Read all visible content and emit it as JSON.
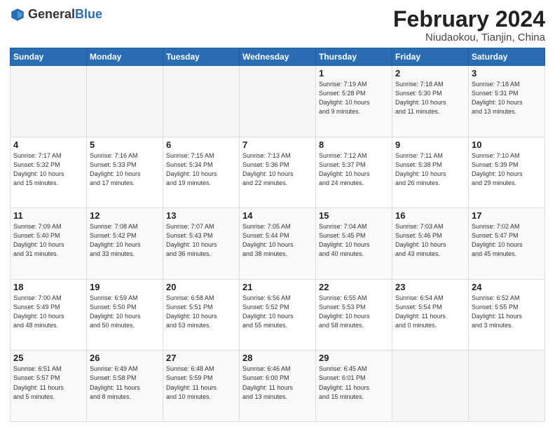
{
  "header": {
    "logo": {
      "general": "General",
      "blue": "Blue"
    },
    "title": "February 2024",
    "subtitle": "Niudaokou, Tianjin, China"
  },
  "days_of_week": [
    "Sunday",
    "Monday",
    "Tuesday",
    "Wednesday",
    "Thursday",
    "Friday",
    "Saturday"
  ],
  "weeks": [
    [
      {
        "num": "",
        "info": ""
      },
      {
        "num": "",
        "info": ""
      },
      {
        "num": "",
        "info": ""
      },
      {
        "num": "",
        "info": ""
      },
      {
        "num": "1",
        "info": "Sunrise: 7:19 AM\nSunset: 5:28 PM\nDaylight: 10 hours\nand 9 minutes."
      },
      {
        "num": "2",
        "info": "Sunrise: 7:18 AM\nSunset: 5:30 PM\nDaylight: 10 hours\nand 11 minutes."
      },
      {
        "num": "3",
        "info": "Sunrise: 7:18 AM\nSunset: 5:31 PM\nDaylight: 10 hours\nand 13 minutes."
      }
    ],
    [
      {
        "num": "4",
        "info": "Sunrise: 7:17 AM\nSunset: 5:32 PM\nDaylight: 10 hours\nand 15 minutes."
      },
      {
        "num": "5",
        "info": "Sunrise: 7:16 AM\nSunset: 5:33 PM\nDaylight: 10 hours\nand 17 minutes."
      },
      {
        "num": "6",
        "info": "Sunrise: 7:15 AM\nSunset: 5:34 PM\nDaylight: 10 hours\nand 19 minutes."
      },
      {
        "num": "7",
        "info": "Sunrise: 7:13 AM\nSunset: 5:36 PM\nDaylight: 10 hours\nand 22 minutes."
      },
      {
        "num": "8",
        "info": "Sunrise: 7:12 AM\nSunset: 5:37 PM\nDaylight: 10 hours\nand 24 minutes."
      },
      {
        "num": "9",
        "info": "Sunrise: 7:11 AM\nSunset: 5:38 PM\nDaylight: 10 hours\nand 26 minutes."
      },
      {
        "num": "10",
        "info": "Sunrise: 7:10 AM\nSunset: 5:39 PM\nDaylight: 10 hours\nand 29 minutes."
      }
    ],
    [
      {
        "num": "11",
        "info": "Sunrise: 7:09 AM\nSunset: 5:40 PM\nDaylight: 10 hours\nand 31 minutes."
      },
      {
        "num": "12",
        "info": "Sunrise: 7:08 AM\nSunset: 5:42 PM\nDaylight: 10 hours\nand 33 minutes."
      },
      {
        "num": "13",
        "info": "Sunrise: 7:07 AM\nSunset: 5:43 PM\nDaylight: 10 hours\nand 36 minutes."
      },
      {
        "num": "14",
        "info": "Sunrise: 7:05 AM\nSunset: 5:44 PM\nDaylight: 10 hours\nand 38 minutes."
      },
      {
        "num": "15",
        "info": "Sunrise: 7:04 AM\nSunset: 5:45 PM\nDaylight: 10 hours\nand 40 minutes."
      },
      {
        "num": "16",
        "info": "Sunrise: 7:03 AM\nSunset: 5:46 PM\nDaylight: 10 hours\nand 43 minutes."
      },
      {
        "num": "17",
        "info": "Sunrise: 7:02 AM\nSunset: 5:47 PM\nDaylight: 10 hours\nand 45 minutes."
      }
    ],
    [
      {
        "num": "18",
        "info": "Sunrise: 7:00 AM\nSunset: 5:49 PM\nDaylight: 10 hours\nand 48 minutes."
      },
      {
        "num": "19",
        "info": "Sunrise: 6:59 AM\nSunset: 5:50 PM\nDaylight: 10 hours\nand 50 minutes."
      },
      {
        "num": "20",
        "info": "Sunrise: 6:58 AM\nSunset: 5:51 PM\nDaylight: 10 hours\nand 53 minutes."
      },
      {
        "num": "21",
        "info": "Sunrise: 6:56 AM\nSunset: 5:52 PM\nDaylight: 10 hours\nand 55 minutes."
      },
      {
        "num": "22",
        "info": "Sunrise: 6:55 AM\nSunset: 5:53 PM\nDaylight: 10 hours\nand 58 minutes."
      },
      {
        "num": "23",
        "info": "Sunrise: 6:54 AM\nSunset: 5:54 PM\nDaylight: 11 hours\nand 0 minutes."
      },
      {
        "num": "24",
        "info": "Sunrise: 6:52 AM\nSunset: 5:55 PM\nDaylight: 11 hours\nand 3 minutes."
      }
    ],
    [
      {
        "num": "25",
        "info": "Sunrise: 6:51 AM\nSunset: 5:57 PM\nDaylight: 11 hours\nand 5 minutes."
      },
      {
        "num": "26",
        "info": "Sunrise: 6:49 AM\nSunset: 5:58 PM\nDaylight: 11 hours\nand 8 minutes."
      },
      {
        "num": "27",
        "info": "Sunrise: 6:48 AM\nSunset: 5:59 PM\nDaylight: 11 hours\nand 10 minutes."
      },
      {
        "num": "28",
        "info": "Sunrise: 6:46 AM\nSunset: 6:00 PM\nDaylight: 11 hours\nand 13 minutes."
      },
      {
        "num": "29",
        "info": "Sunrise: 6:45 AM\nSunset: 6:01 PM\nDaylight: 11 hours\nand 15 minutes."
      },
      {
        "num": "",
        "info": ""
      },
      {
        "num": "",
        "info": ""
      }
    ]
  ]
}
